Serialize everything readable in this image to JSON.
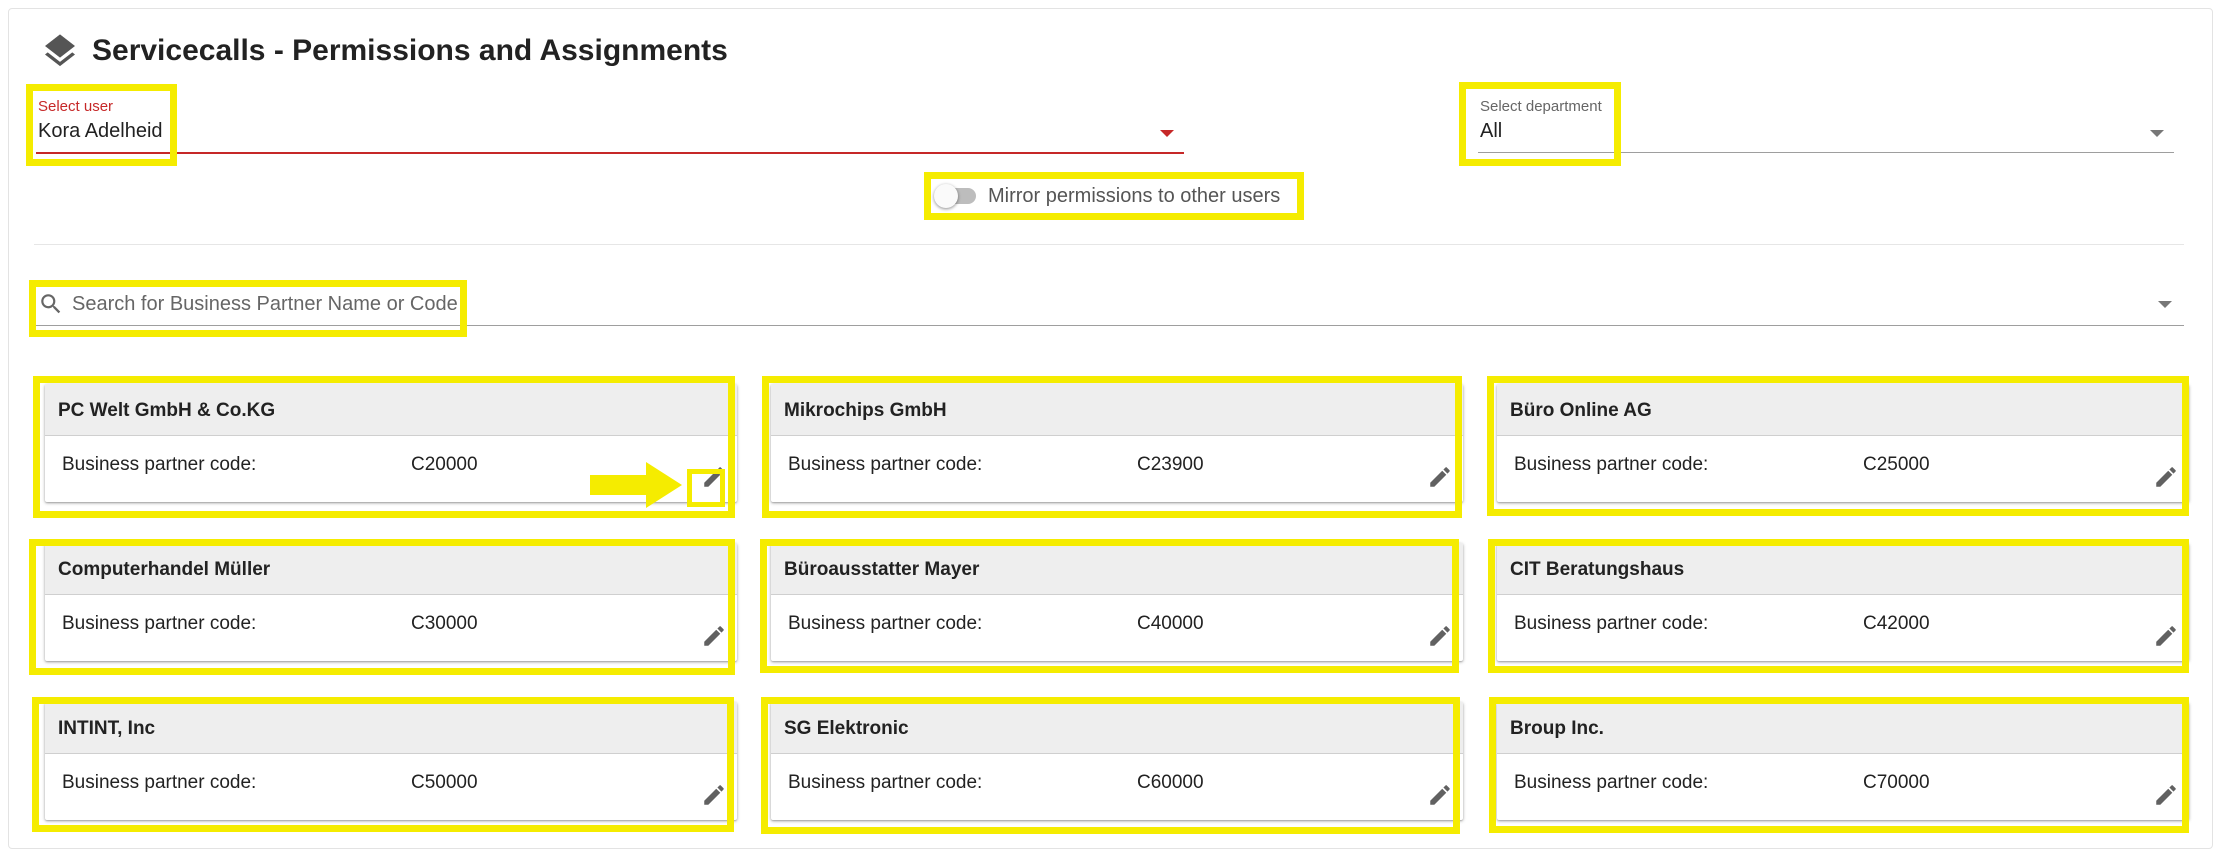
{
  "header": {
    "title": "Servicecalls - Permissions and Assignments",
    "icon": "layers-icon"
  },
  "user_select": {
    "label": "Select user",
    "value": "Kora Adelheid",
    "accent_color": "#c62828"
  },
  "department_select": {
    "label": "Select department",
    "value": "All"
  },
  "mirror_toggle": {
    "label": "Mirror permissions to other users",
    "checked": false
  },
  "search": {
    "placeholder": "Search for Business Partner Name or Code",
    "value": ""
  },
  "cards": [
    {
      "name": "PC Welt GmbH & Co.KG",
      "code_label": "Business partner code:",
      "code": "C20000"
    },
    {
      "name": "Mikrochips GmbH",
      "code_label": "Business partner code:",
      "code": "C23900"
    },
    {
      "name": "Büro Online AG",
      "code_label": "Business partner code:",
      "code": "C25000"
    },
    {
      "name": "Computerhandel Müller",
      "code_label": "Business partner code:",
      "code": "C30000"
    },
    {
      "name": "Büroausstatter Mayer",
      "code_label": "Business partner code:",
      "code": "C40000"
    },
    {
      "name": "CIT Beratungshaus",
      "code_label": "Business partner code:",
      "code": "C42000"
    },
    {
      "name": "INTINT, Inc",
      "code_label": "Business partner code:",
      "code": "C50000"
    },
    {
      "name": "SG Elektronic",
      "code_label": "Business partner code:",
      "code": "C60000"
    },
    {
      "name": "Broup Inc.",
      "code_label": "Business partner code:",
      "code": "C70000"
    }
  ],
  "colors": {
    "highlight": "#f5ec00",
    "card_header_bg": "#eeeeee",
    "accent_red": "#c62828",
    "icon_gray": "#616161"
  }
}
